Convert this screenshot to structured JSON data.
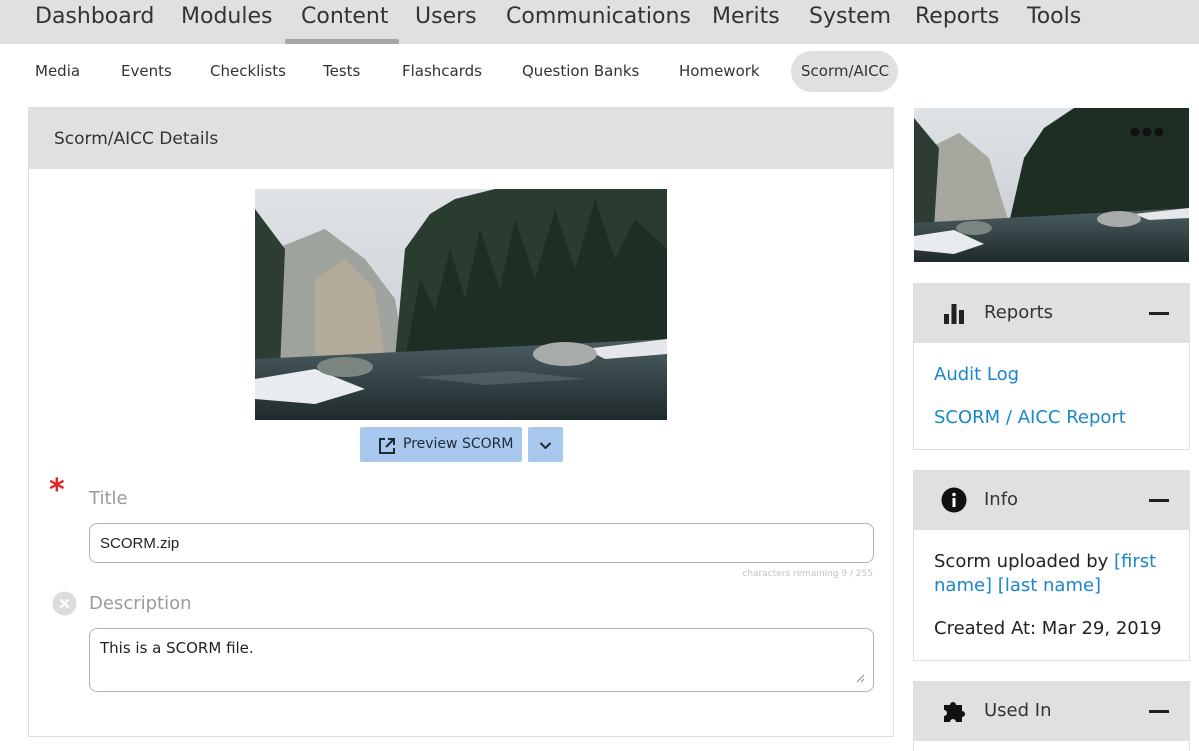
{
  "top_nav": {
    "items": [
      "Dashboard",
      "Modules",
      "Content",
      "Users",
      "Communications",
      "Merits",
      "System",
      "Reports",
      "Tools"
    ],
    "active": "Content"
  },
  "sub_nav": {
    "items": [
      "Media",
      "Events",
      "Checklists",
      "Tests",
      "Flashcards",
      "Question Banks",
      "Homework",
      "Scorm/AICC"
    ],
    "active": "Scorm/AICC"
  },
  "details": {
    "header": "Scorm/AICC Details",
    "preview_button": "Preview SCORM",
    "title_label": "Title",
    "title_value": "SCORM.zip",
    "char_counter": "characters remaining 9 / 255",
    "description_label": "Description",
    "description_value": "This is a SCORM file."
  },
  "reports_panel": {
    "title": "Reports",
    "links": [
      "Audit Log",
      "SCORM / AICC Report"
    ]
  },
  "info_panel": {
    "title": "Info",
    "uploaded_prefix": "Scorm uploaded by ",
    "uploaded_first": "[first",
    "uploaded_name_line2": "name] [last name]",
    "created_at": "Created At: Mar 29, 2019"
  },
  "used_in_panel": {
    "title": "Used In"
  },
  "colors": {
    "nav_bg": "#e0e0e0",
    "link": "#1a87c9",
    "button": "#a9c8ee",
    "required": "#e02424"
  },
  "icons": [
    "external-link-icon",
    "chevron-down-icon",
    "clear-icon",
    "more-dots-icon",
    "bar-chart-icon",
    "info-icon",
    "puzzle-icon",
    "collapse-icon"
  ]
}
